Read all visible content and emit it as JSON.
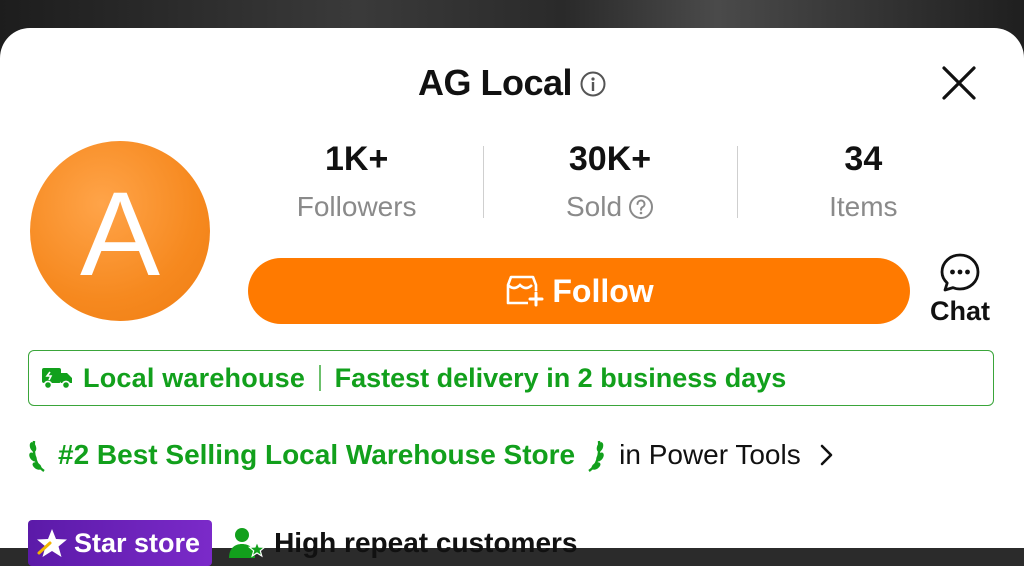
{
  "header": {
    "title": "AG Local",
    "info_icon": "info-icon",
    "close_icon": "close-icon"
  },
  "avatar": {
    "letter": "A",
    "color": "#f6891f"
  },
  "stats": [
    {
      "value": "1K+",
      "label": "Followers"
    },
    {
      "value": "30K+",
      "label": "Sold",
      "help_icon": "question-circle-icon"
    },
    {
      "value": "34",
      "label": "Items"
    }
  ],
  "follow": {
    "label": "Follow",
    "icon": "store-plus-icon",
    "color": "#ff7a00"
  },
  "chat": {
    "label": "Chat",
    "icon": "chat-bubble-icon"
  },
  "warehouse": {
    "icon": "truck-icon",
    "label": "Local warehouse",
    "delivery": "Fastest delivery in 2 business days",
    "color": "#12a01c"
  },
  "ranking": {
    "text": "#2 Best Selling Local Warehouse Store",
    "category": "in Power Tools",
    "icon": "chevron-right-icon"
  },
  "badges": {
    "star_store": "Star store",
    "repeat": "High repeat customers"
  }
}
